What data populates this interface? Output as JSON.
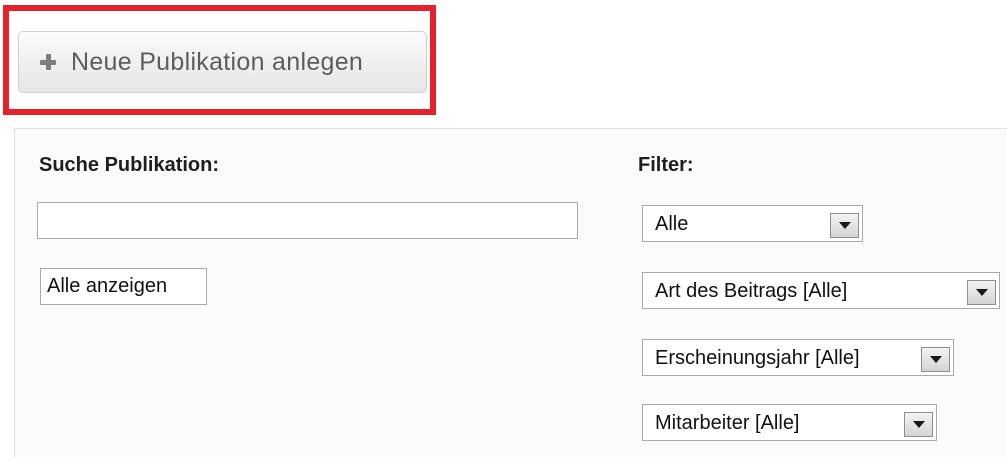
{
  "toolbar": {
    "new_publication_label": "Neue Publikation anlegen",
    "new_publication_icon": "plus-icon",
    "highlight_color": "#e4222b"
  },
  "search": {
    "heading": "Suche Publikation:",
    "value": "",
    "show_all_label": "Alle anzeigen"
  },
  "filter": {
    "heading": "Filter:",
    "selects": [
      {
        "value": "Alle"
      },
      {
        "value": "Art des Beitrags [Alle]"
      },
      {
        "value": "Erscheinungsjahr [Alle]"
      },
      {
        "value": "Mitarbeiter [Alle]"
      }
    ]
  }
}
